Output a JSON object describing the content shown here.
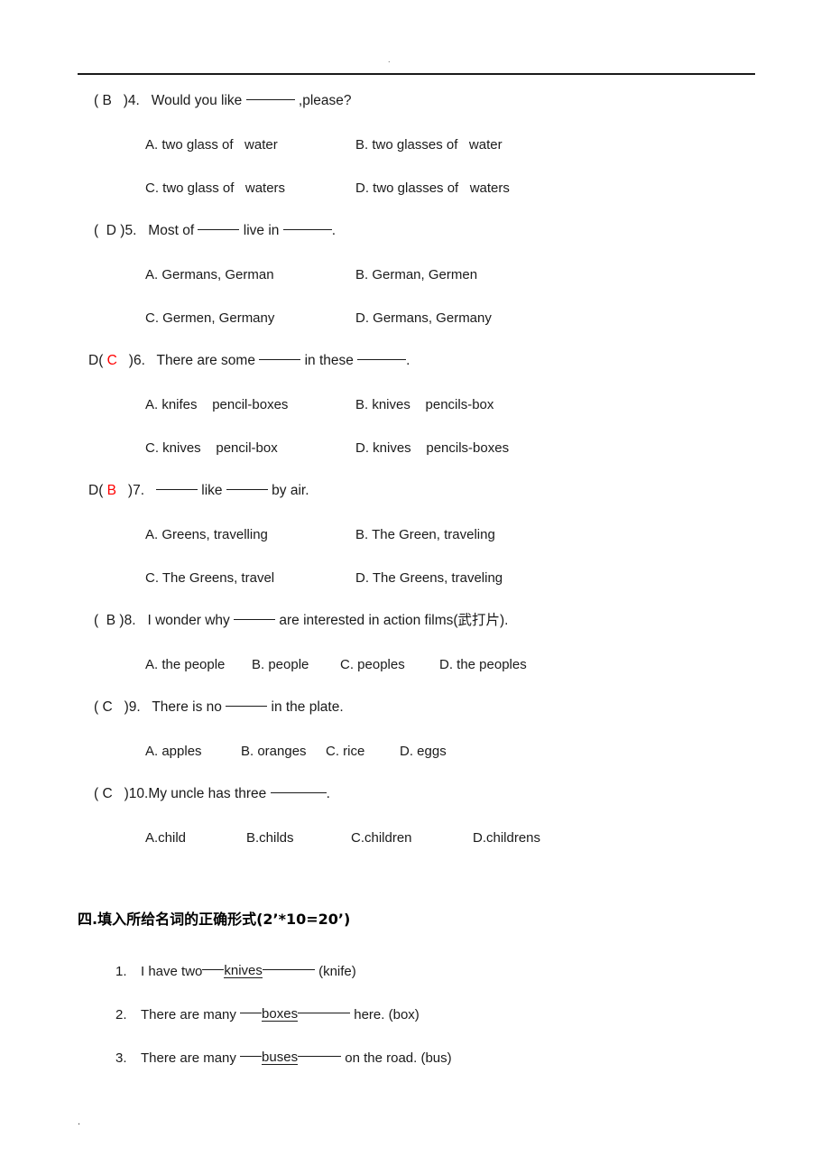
{
  "header": {
    "mark": "."
  },
  "footer": {
    "mark": "."
  },
  "multiple_choice": {
    "questions": [
      {
        "prefix": "( ",
        "answer": "B",
        "answer_color": "#1a1a1a",
        "close": "   )",
        "number": "4.",
        "stem_before": "   Would you like ",
        "stem_after": " ,please?",
        "options": [
          "A. two glass of   water",
          "B. two glasses of   water",
          "C. two glass of   waters",
          "D. two glasses of   waters"
        ]
      },
      {
        "prefix": "(  ",
        "answer": "D",
        "answer_color": "#1a1a1a",
        "close": " )",
        "number": "5.",
        "stem_before": "   Most of ",
        "stem_mid": " live in ",
        "stem_after": ".",
        "options": [
          "A. Germans, German",
          "B. German, Germen",
          "C. Germen, Germany",
          "D. Germans, Germany"
        ]
      },
      {
        "prefix": "D( ",
        "answer": "C",
        "answer_color": "#ff0000",
        "close": "   )",
        "number": "6.",
        "stem_before": "   There are some ",
        "stem_mid": " in these ",
        "stem_after": ".",
        "options": [
          "A. knifes    pencil-boxes",
          "B. knives    pencils-box",
          "C. knives    pencil-box",
          "D. knives    pencils-boxes"
        ]
      },
      {
        "prefix": "D( ",
        "answer": "B",
        "answer_color": "#ff0000",
        "close": "   )",
        "number": "7.",
        "stem_before": "   ",
        "stem_mid": " like ",
        "stem_after": " by air.",
        "options": [
          "A. Greens, travelling",
          "B. The Green, traveling",
          "C. The Greens, travel",
          "D. The Greens, traveling"
        ]
      },
      {
        "prefix": "(  ",
        "answer": "B",
        "answer_color": "#1a1a1a",
        "close": " )",
        "number": "8.",
        "stem_before": "   I wonder why ",
        "stem_after": " are interested in action films(武打片).",
        "options": [
          "A. the people",
          "B. people",
          "C. peoples",
          "D. the peoples"
        ]
      },
      {
        "prefix": "( ",
        "answer": "C",
        "answer_color": "#1a1a1a",
        "close": "   )",
        "number": "9.",
        "stem_before": "   There is no ",
        "stem_after": " in the plate.",
        "options": [
          "A. apples",
          "B. oranges",
          "C. rice",
          "D. eggs"
        ]
      },
      {
        "prefix": "( ",
        "answer": "C",
        "answer_color": "#1a1a1a",
        "close": "   )",
        "number": "10.",
        "stem_before": "My uncle has three ",
        "stem_after": ".",
        "options": [
          "A.child",
          "B.childs",
          "C.children",
          "D.childrens"
        ]
      }
    ]
  },
  "section_four": {
    "heading": "四.填入所给名词的正确形式(2’*10=20’)",
    "items": [
      {
        "number": "1.",
        "text_before": "I have two",
        "answer": "knives",
        "text_after": " (knife)"
      },
      {
        "number": "2.",
        "text_before": "There are many ",
        "answer": "boxes",
        "text_after": " here. (box)"
      },
      {
        "number": "3.",
        "text_before": "There are many ",
        "answer": "buses",
        "text_after": " on the road. (bus)"
      }
    ]
  }
}
